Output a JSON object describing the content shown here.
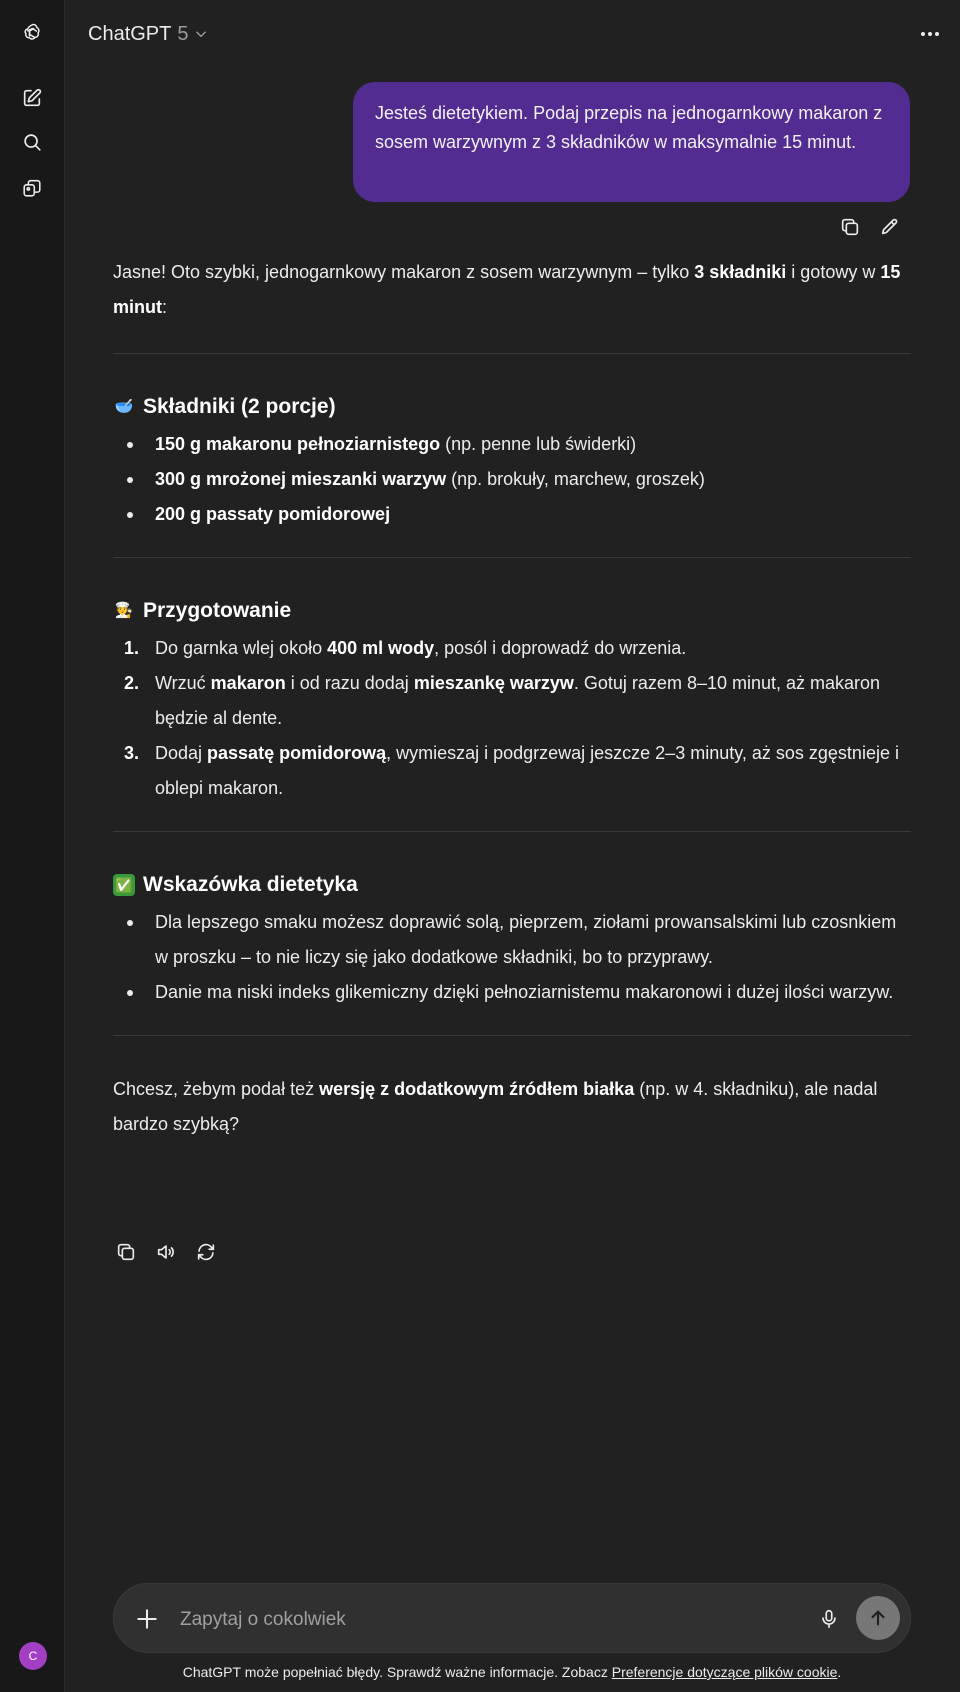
{
  "header": {
    "model_name": "ChatGPT",
    "model_version": "5"
  },
  "user_message": "Jesteś dietetykiem. Podaj przepis na jednogarnkowy makaron z sosem warzywnym z 3 składników w maksymalnie 15 minut.",
  "answer": {
    "intro": {
      "t1": "Jasne! Oto szybki, jednogarnkowy makaron z sosem warzywnym – tylko ",
      "b1": "3 składniki",
      "t2": " i gotowy w ",
      "b2": "15 minut",
      "t3": ":"
    },
    "ingredients": {
      "emoji": "🥣",
      "title": "Składniki (2 porcje)",
      "items": [
        {
          "bold": "150 g makaronu pełnoziarnistego",
          "rest": " (np. penne lub świderki)"
        },
        {
          "bold": "300 g mrożonej mieszanki warzyw",
          "rest": " (np. brokuły, marchew, groszek)"
        },
        {
          "bold": "200 g passaty pomidorowej",
          "rest": ""
        }
      ]
    },
    "preparation": {
      "emoji": "🧑‍🍳",
      "title": "Przygotowanie",
      "steps": [
        {
          "num": "1.",
          "t1": "Do garnka wlej około ",
          "b1": "400 ml wody",
          "t2": ", posól i doprowadź do wrzenia."
        },
        {
          "num": "2.",
          "t1": "Wrzuć ",
          "b1": "makaron",
          "t2": " i od razu dodaj ",
          "b2": "mieszankę warzyw",
          "t3": ". Gotuj razem 8–10 minut, aż makaron będzie al dente."
        },
        {
          "num": "3.",
          "t1": "Dodaj ",
          "b1": "passatę pomidorową",
          "t2": ", wymieszaj i podgrzewaj jeszcze 2–3 minuty, aż sos zgęstnieje i oblepi makaron."
        }
      ]
    },
    "tip": {
      "emoji": "✅",
      "title": "Wskazówka dietetyka",
      "items": [
        "Dla lepszego smaku możesz doprawić solą, pieprzem, ziołami prowansalskimi lub czosnkiem w proszku – to nie liczy się jako dodatkowe składniki, bo to przyprawy.",
        "Danie ma niski indeks glikemiczny dzięki pełnoziarnistemu makaronowi i dużej ilości warzyw."
      ]
    },
    "closing": {
      "t1": "Chcesz, żebym podał też ",
      "b1": "wersję z dodatkowym źródłem białka",
      "t2": " (np. w 4. składniku), ale nadal bardzo szybką?"
    }
  },
  "composer": {
    "placeholder": "Zapytaj o cokolwiek"
  },
  "footer": {
    "text": "ChatGPT może popełniać błędy. Sprawdź ważne informacje. Zobacz ",
    "link": "Preferencje dotyczące plików cookie",
    "end": "."
  },
  "avatar_initial": "C",
  "colors": {
    "background": "#212121",
    "sidebar": "#181818",
    "user_bubble": "#532c91",
    "avatar": "#a23fc3"
  },
  "icons": [
    "openai-logo-icon",
    "new-chat-icon",
    "search-icon",
    "library-icon",
    "chevron-down-icon",
    "more-icon",
    "copy-icon",
    "edit-icon",
    "read-aloud-icon",
    "regenerate-icon",
    "plus-icon",
    "mic-icon",
    "send-arrow-icon"
  ]
}
